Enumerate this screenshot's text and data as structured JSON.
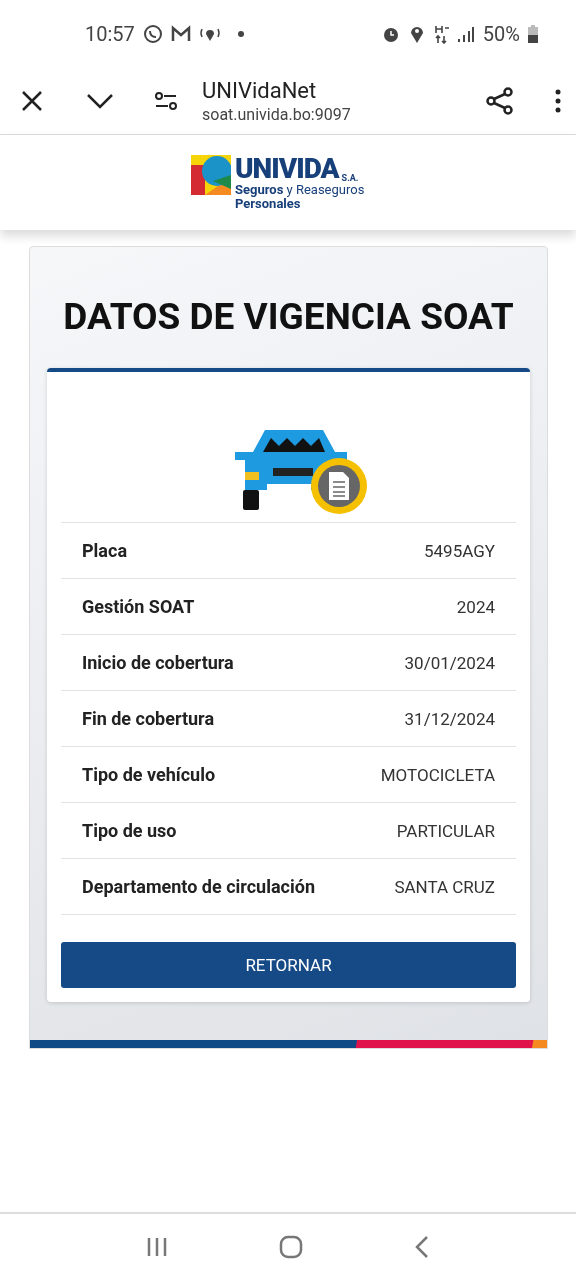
{
  "status_bar": {
    "time": "10:57",
    "battery": "50%"
  },
  "browser_bar": {
    "title": "UNIVidaNet",
    "url": "soat.univida.bo:9097"
  },
  "logo": {
    "name": "UNIVIDA",
    "suffix": "S.A.",
    "tagline": "**Seguros** y Reaseguros **Personales**"
  },
  "page_title": "DATOS DE VIGENCIA SOAT",
  "details": [
    {
      "label": "Placa",
      "value": "5495AGY"
    },
    {
      "label": "Gestión SOAT",
      "value": "2024"
    },
    {
      "label": "Inicio de cobertura",
      "value": "30/01/2024"
    },
    {
      "label": "Fin de cobertura",
      "value": "31/12/2024"
    },
    {
      "label": "Tipo de vehículo",
      "value": "MOTOCICLETA"
    },
    {
      "label": "Tipo de uso",
      "value": "PARTICULAR"
    },
    {
      "label": "Departamento de circulación",
      "value": "SANTA CRUZ"
    }
  ],
  "button": "RETORNAR"
}
